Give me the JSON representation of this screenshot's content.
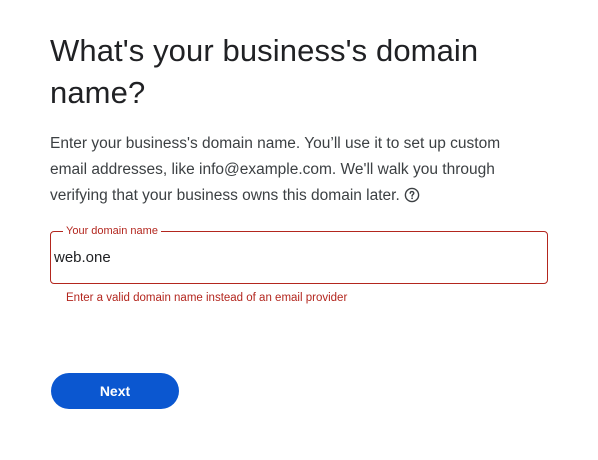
{
  "header": {
    "title": "What's your business's domain name?"
  },
  "description": {
    "text": "Enter your business's domain name. You’ll use it to set up custom email addresses, like info@example.com. We'll walk you through verifying that your business owns this domain later.",
    "help_icon": "help-circle-icon"
  },
  "domain_field": {
    "label": "Your domain name",
    "value": "web.one",
    "error": "Enter a valid domain name instead of an email provider"
  },
  "actions": {
    "next_label": "Next"
  },
  "colors": {
    "primary": "#0b57d0",
    "error": "#b3261e",
    "text": "#202124"
  }
}
